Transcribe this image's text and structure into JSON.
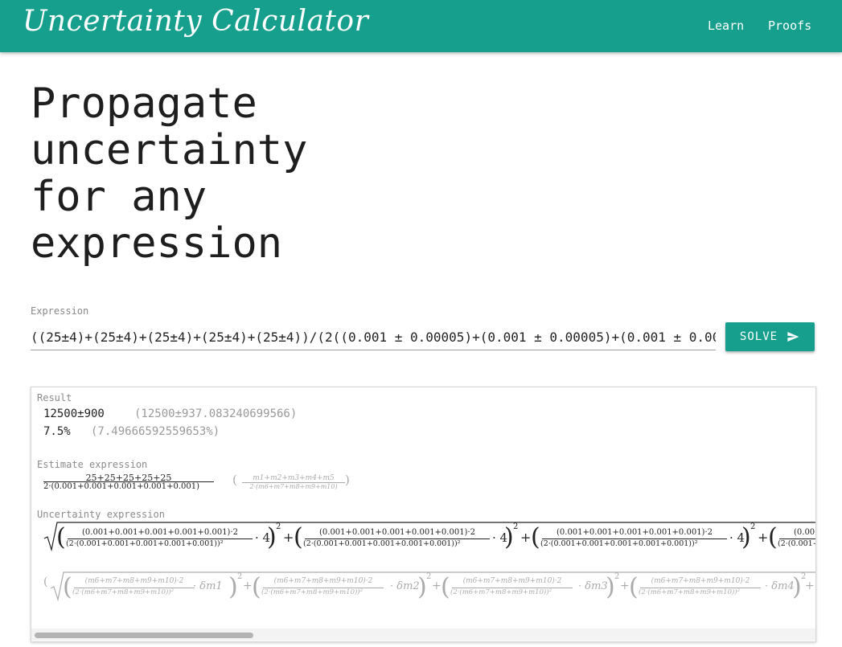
{
  "app": {
    "brand": "Uncertainty Calculator",
    "nav": [
      "Learn",
      "Proofs"
    ]
  },
  "hero": {
    "lines": [
      "Propagate",
      "uncertainty",
      "for any",
      "expression"
    ]
  },
  "input": {
    "label": "Expression",
    "value": "((25±4)+(25±4)+(25±4)+(25±4)+(25±4))/(2((0.001 ± 0.00005)+(0.001 ± 0.00005)+(0.001 ± 0.00",
    "solve_label": "SOLVE"
  },
  "result": {
    "label": "Result",
    "value": "12500±900",
    "value_exact": "(12500±937.083240699566)",
    "percent": "7.5%",
    "percent_exact": "(7.49666592559653%)"
  },
  "estimate": {
    "label": "Estimate expression",
    "numerator": "25+25+25+25+25",
    "denominator": "2·(0.001+0.001+0.001+0.001+0.001)",
    "sym_numerator": "m1+m2+m3+m4+m5",
    "sym_denominator": "2·(m6+m7+m8+m9+m10)"
  },
  "uncertainty": {
    "label": "Uncertainty expression",
    "term_numerator": "(0.001+0.001+0.001+0.001+0.001)·2",
    "term_denominator": "(2·(0.001+0.001+0.001+0.001+0.001))²",
    "term_factor": "· 4",
    "sym_term_numerator": "(m6+m7+m8+m9+m10)·2",
    "sym_term_denominator": "(2·(m6+m7+m8+m9+m10))²",
    "sym_factors": [
      "· δm1",
      "· δm2",
      "· δm3",
      "· δm4"
    ]
  },
  "colors": {
    "primary": "#159f8c",
    "text": "#1e1e1e",
    "muted": "#9a9a9a"
  },
  "icons": {
    "solve": "send-icon"
  }
}
